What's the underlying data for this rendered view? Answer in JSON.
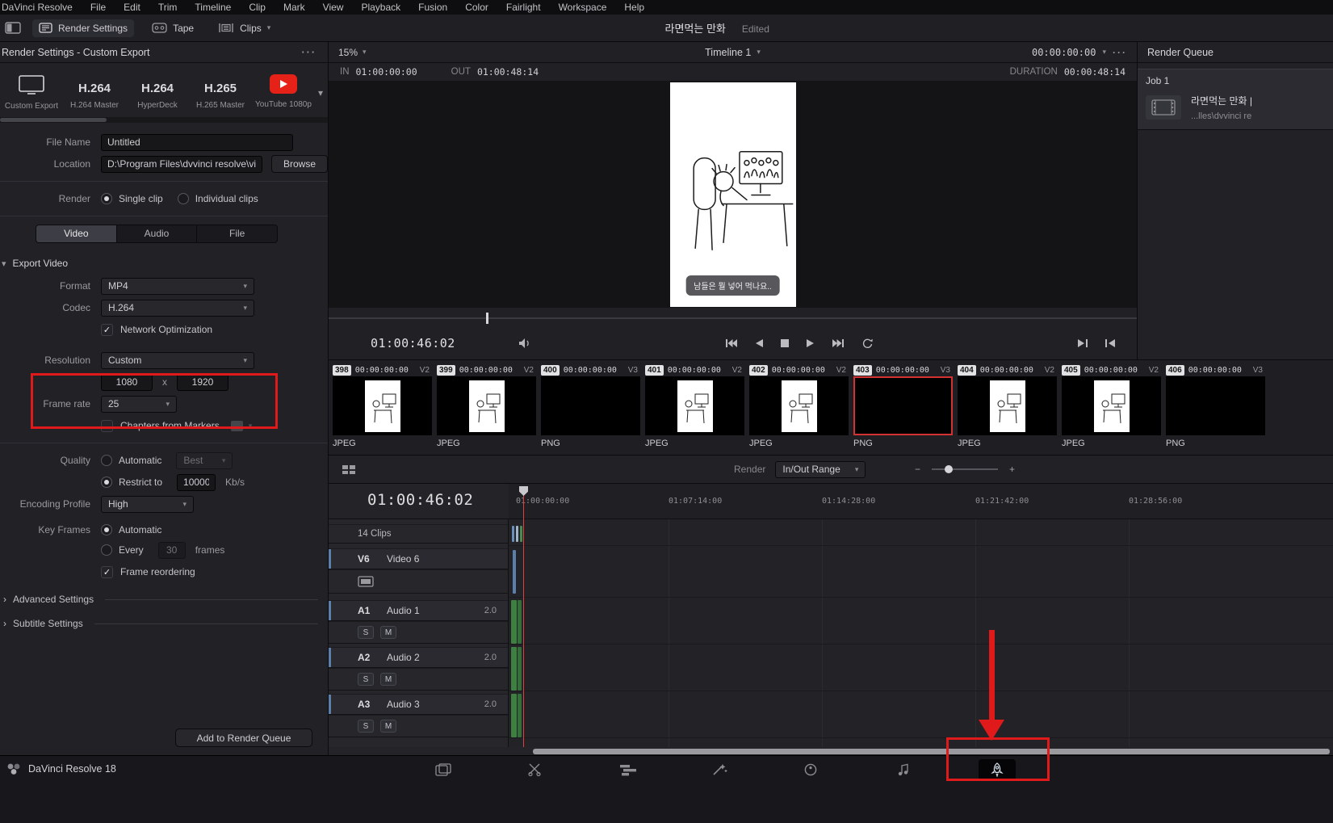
{
  "icons": {
    "kebab": "···",
    "chevron": "▾",
    "collapse_arrow": "›",
    "check": "✓",
    "minus": "−",
    "plus": "+"
  },
  "menu": {
    "items": [
      "DaVinci Resolve",
      "File",
      "Edit",
      "Trim",
      "Timeline",
      "Clip",
      "Mark",
      "View",
      "Playback",
      "Fusion",
      "Color",
      "Fairlight",
      "Workspace",
      "Help"
    ]
  },
  "toolbar": {
    "render_settings_label": "Render Settings",
    "tape_label": "Tape",
    "clips_label": "Clips",
    "project_title": "라면먹는 만화",
    "edited_label": "Edited"
  },
  "render_settings": {
    "header": "Render Settings - Custom Export",
    "presets": [
      {
        "title": "",
        "subtitle": "Custom Export"
      },
      {
        "title": "H.264",
        "subtitle": "H.264 Master"
      },
      {
        "title": "H.264",
        "subtitle": "HyperDeck"
      },
      {
        "title": "H.265",
        "subtitle": "H.265 Master"
      },
      {
        "title": "",
        "subtitle": "YouTube 1080p"
      }
    ],
    "file_name": {
      "label": "File Name",
      "value": "Untitled"
    },
    "location": {
      "label": "Location",
      "value": "D:\\Program Files\\dvvinci resolve\\videos",
      "browse": "Browse"
    },
    "render": {
      "label": "Render",
      "single": "Single clip",
      "individual": "Individual clips"
    },
    "tabs": [
      "Video",
      "Audio",
      "File"
    ],
    "export_video": "Export Video",
    "format": {
      "label": "Format",
      "value": "MP4"
    },
    "codec": {
      "label": "Codec",
      "value": "H.264"
    },
    "network_optimization": "Network Optimization",
    "resolution": {
      "label": "Resolution",
      "value": "Custom",
      "width": "1080",
      "x": "x",
      "height": "1920"
    },
    "frame_rate": {
      "label": "Frame rate",
      "value": "25"
    },
    "chapters": "Chapters from Markers",
    "quality": {
      "label": "Quality",
      "automatic": "Automatic",
      "best": "Best",
      "restrict": "Restrict to",
      "bitrate": "10000",
      "unit": "Kb/s"
    },
    "encoding_profile": {
      "label": "Encoding Profile",
      "value": "High"
    },
    "key_frames": {
      "label": "Key Frames",
      "automatic": "Automatic",
      "every": "Every",
      "value": "30",
      "unit": "frames"
    },
    "frame_reordering": "Frame reordering",
    "advanced_settings": "Advanced Settings",
    "subtitle_settings": "Subtitle Settings",
    "add_button": "Add to Render Queue"
  },
  "viewer": {
    "zoom": "15%",
    "timeline_name": "Timeline 1",
    "header_timecode": "00:00:00:00",
    "in_label": "IN",
    "in_value": "01:00:00:00",
    "out_label": "OUT",
    "out_value": "01:00:48:14",
    "duration_label": "DURATION",
    "duration_value": "00:00:48:14",
    "current_timecode": "01:00:46:02",
    "subtitle_overlay": "남들은 뭘 넣어 먹나요.."
  },
  "clip_strip": {
    "clips": [
      {
        "num": "398",
        "timecode": "00:00:00:00",
        "track": "V2",
        "format": "JPEG"
      },
      {
        "num": "399",
        "timecode": "00:00:00:00",
        "track": "V2",
        "format": "JPEG"
      },
      {
        "num": "400",
        "timecode": "00:00:00:00",
        "track": "V3",
        "format": "PNG"
      },
      {
        "num": "401",
        "timecode": "00:00:00:00",
        "track": "V2",
        "format": "JPEG"
      },
      {
        "num": "402",
        "timecode": "00:00:00:00",
        "track": "V2",
        "format": "JPEG"
      },
      {
        "num": "403",
        "timecode": "00:00:00:00",
        "track": "V3",
        "format": "PNG"
      },
      {
        "num": "404",
        "timecode": "00:00:00:00",
        "track": "V2",
        "format": "JPEG"
      },
      {
        "num": "405",
        "timecode": "00:00:00:00",
        "track": "V2",
        "format": "JPEG"
      },
      {
        "num": "406",
        "timecode": "00:00:00:00",
        "track": "V3",
        "format": "PNG"
      }
    ]
  },
  "render_bar": {
    "label": "Render",
    "range": "In/Out Range"
  },
  "timeline": {
    "timecode": "01:00:46:02",
    "ruler": [
      "01:00:00:00",
      "01:07:14:00",
      "01:14:28:00",
      "01:21:42:00",
      "01:28:56:00"
    ],
    "clip_count": "14 Clips",
    "video_track": {
      "id": "V6",
      "name": "Video 6"
    },
    "audio_tracks": [
      {
        "id": "A1",
        "name": "Audio 1",
        "channels": "2.0"
      },
      {
        "id": "A2",
        "name": "Audio 2",
        "channels": "2.0"
      },
      {
        "id": "A3",
        "name": "Audio 3",
        "channels": "2.0"
      }
    ],
    "solo": "S",
    "mute": "M"
  },
  "render_queue": {
    "header": "Render Queue",
    "job_label": "Job 1",
    "job_title": "라면먹는 만화 |",
    "job_path": "...lles\\dvvinci re"
  },
  "status": {
    "app": "DaVinci Resolve 18"
  },
  "colors": {
    "annotation": "#e01a1a",
    "youtube": "#e62117",
    "selected_clip_border": "#d23232"
  }
}
